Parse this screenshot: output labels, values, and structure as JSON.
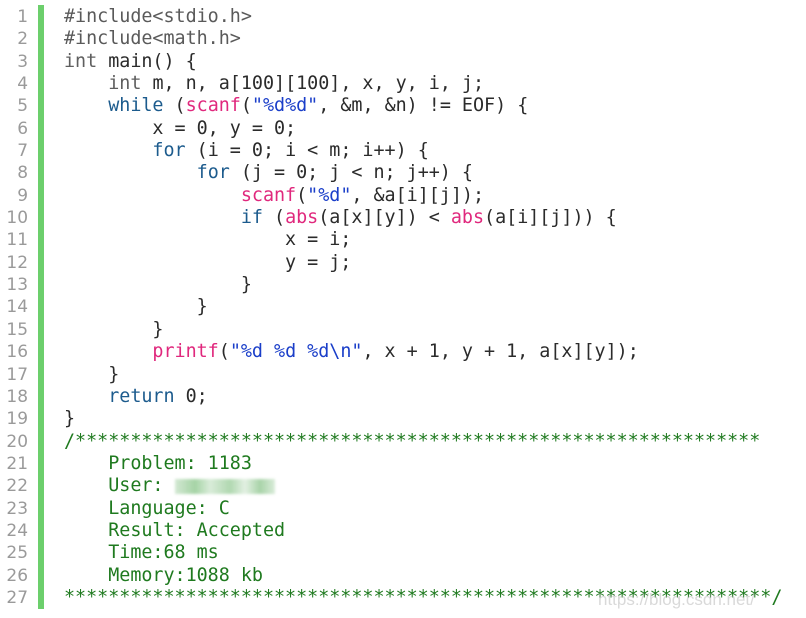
{
  "editor": {
    "accent_bar_color": "#6ccf6c",
    "lines": [
      {
        "n": "1",
        "tokens": [
          {
            "t": "pp",
            "v": "#include<stdio.h>"
          }
        ]
      },
      {
        "n": "2",
        "tokens": [
          {
            "t": "pp",
            "v": "#include<math.h>"
          }
        ]
      },
      {
        "n": "3",
        "tokens": [
          {
            "t": "type",
            "v": "int"
          },
          {
            "t": "",
            "v": " main() {"
          }
        ]
      },
      {
        "n": "4",
        "tokens": [
          {
            "t": "",
            "v": "    "
          },
          {
            "t": "type",
            "v": "int"
          },
          {
            "t": "",
            "v": " m, n, a[100][100], x, y, i, j;"
          }
        ]
      },
      {
        "n": "5",
        "tokens": [
          {
            "t": "",
            "v": "    "
          },
          {
            "t": "kw",
            "v": "while"
          },
          {
            "t": "",
            "v": " ("
          },
          {
            "t": "fn",
            "v": "scanf"
          },
          {
            "t": "",
            "v": "("
          },
          {
            "t": "str",
            "v": "\"%d%d\""
          },
          {
            "t": "",
            "v": ", &m, &n) != EOF) {"
          }
        ]
      },
      {
        "n": "6",
        "tokens": [
          {
            "t": "",
            "v": "        x = 0, y = 0;"
          }
        ]
      },
      {
        "n": "7",
        "tokens": [
          {
            "t": "",
            "v": "        "
          },
          {
            "t": "kw",
            "v": "for"
          },
          {
            "t": "",
            "v": " (i = 0; i < m; i++) {"
          }
        ]
      },
      {
        "n": "8",
        "tokens": [
          {
            "t": "",
            "v": "            "
          },
          {
            "t": "kw",
            "v": "for"
          },
          {
            "t": "",
            "v": " (j = 0; j < n; j++) {"
          }
        ]
      },
      {
        "n": "9",
        "tokens": [
          {
            "t": "",
            "v": "                "
          },
          {
            "t": "fn",
            "v": "scanf"
          },
          {
            "t": "",
            "v": "("
          },
          {
            "t": "str",
            "v": "\"%d\""
          },
          {
            "t": "",
            "v": ", &a[i][j]);"
          }
        ]
      },
      {
        "n": "10",
        "tokens": [
          {
            "t": "",
            "v": "                "
          },
          {
            "t": "kw",
            "v": "if"
          },
          {
            "t": "",
            "v": " ("
          },
          {
            "t": "fn",
            "v": "abs"
          },
          {
            "t": "",
            "v": "(a[x][y]) < "
          },
          {
            "t": "fn",
            "v": "abs"
          },
          {
            "t": "",
            "v": "(a[i][j])) {"
          }
        ]
      },
      {
        "n": "11",
        "tokens": [
          {
            "t": "",
            "v": "                    x = i;"
          }
        ]
      },
      {
        "n": "12",
        "tokens": [
          {
            "t": "",
            "v": "                    y = j;"
          }
        ]
      },
      {
        "n": "13",
        "tokens": [
          {
            "t": "",
            "v": "                }"
          }
        ]
      },
      {
        "n": "14",
        "tokens": [
          {
            "t": "",
            "v": "            }"
          }
        ]
      },
      {
        "n": "15",
        "tokens": [
          {
            "t": "",
            "v": "        }"
          }
        ]
      },
      {
        "n": "16",
        "tokens": [
          {
            "t": "",
            "v": "        "
          },
          {
            "t": "fn",
            "v": "printf"
          },
          {
            "t": "",
            "v": "("
          },
          {
            "t": "str",
            "v": "\"%d %d %d\\n\""
          },
          {
            "t": "",
            "v": ", x + 1, y + 1, a[x][y]);"
          }
        ]
      },
      {
        "n": "17",
        "tokens": [
          {
            "t": "",
            "v": "    }"
          }
        ]
      },
      {
        "n": "18",
        "tokens": [
          {
            "t": "",
            "v": "    "
          },
          {
            "t": "kw",
            "v": "return"
          },
          {
            "t": "",
            "v": " 0;"
          }
        ]
      },
      {
        "n": "19",
        "tokens": [
          {
            "t": "",
            "v": "}"
          }
        ]
      },
      {
        "n": "20",
        "tokens": [
          {
            "t": "cm",
            "v": "/**************************************************************"
          }
        ]
      },
      {
        "n": "21",
        "tokens": [
          {
            "t": "cm",
            "v": "    Problem: 1183"
          }
        ]
      },
      {
        "n": "22",
        "tokens": [
          {
            "t": "cm",
            "v": "    User: "
          },
          {
            "t": "blur",
            "v": ""
          }
        ]
      },
      {
        "n": "23",
        "tokens": [
          {
            "t": "cm",
            "v": "    Language: C"
          }
        ]
      },
      {
        "n": "24",
        "tokens": [
          {
            "t": "cm",
            "v": "    Result: Accepted"
          }
        ]
      },
      {
        "n": "25",
        "tokens": [
          {
            "t": "cm",
            "v": "    Time:68 ms"
          }
        ]
      },
      {
        "n": "26",
        "tokens": [
          {
            "t": "cm",
            "v": "    Memory:1088 kb"
          }
        ]
      },
      {
        "n": "27",
        "tokens": [
          {
            "t": "cm",
            "v": "****************************************************************/"
          }
        ]
      }
    ]
  },
  "submission": {
    "problem": "1183",
    "language": "C",
    "result": "Accepted",
    "time": "68 ms",
    "memory": "1088 kb"
  },
  "watermark": "https://blog.csdn.net/"
}
